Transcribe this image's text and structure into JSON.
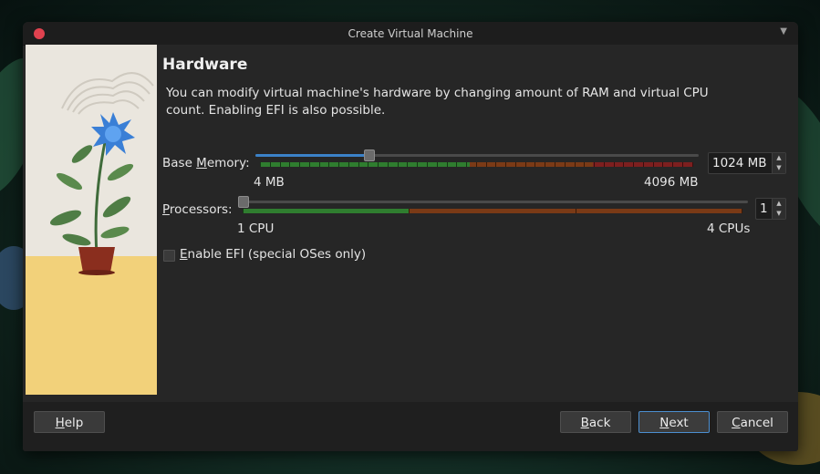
{
  "window": {
    "title": "Create Virtual Machine"
  },
  "page": {
    "heading": "Hardware",
    "description": "You can modify virtual machine's hardware by changing amount of RAM and virtual CPU count. Enabling EFI is also possible."
  },
  "memory": {
    "label_prefix": "Base ",
    "label_mnemonic": "M",
    "label_suffix": "emory:",
    "value": "1024 MB",
    "min_label": "4 MB",
    "max_label": "4096 MB",
    "level_fraction": 0.25
  },
  "processors": {
    "label_mnemonic": "P",
    "label_suffix": "rocessors:",
    "value": "1",
    "min_label": "1 CPU",
    "max_label": "4 CPUs",
    "level_fraction": 0.0
  },
  "efi": {
    "label_mnemonic": "E",
    "label_suffix": "nable EFI (special OSes only)",
    "checked": false
  },
  "buttons": {
    "help_mnemonic": "H",
    "help_rest": "elp",
    "back_mnemonic": "B",
    "back_rest": "ack",
    "next_mnemonic": "N",
    "next_rest": "ext",
    "cancel_mnemonic": "C",
    "cancel_rest": "ancel"
  },
  "icons": {
    "close": "close-icon",
    "menu": "chevron-down-icon",
    "spin_up": "arrow-up-icon",
    "spin_down": "arrow-down-icon"
  },
  "colors": {
    "accent": "#3b82c8",
    "zone_green": "#2f7d2f",
    "zone_orange": "#7a3a16",
    "zone_red": "#7d1f1f",
    "close": "#e0424f"
  }
}
